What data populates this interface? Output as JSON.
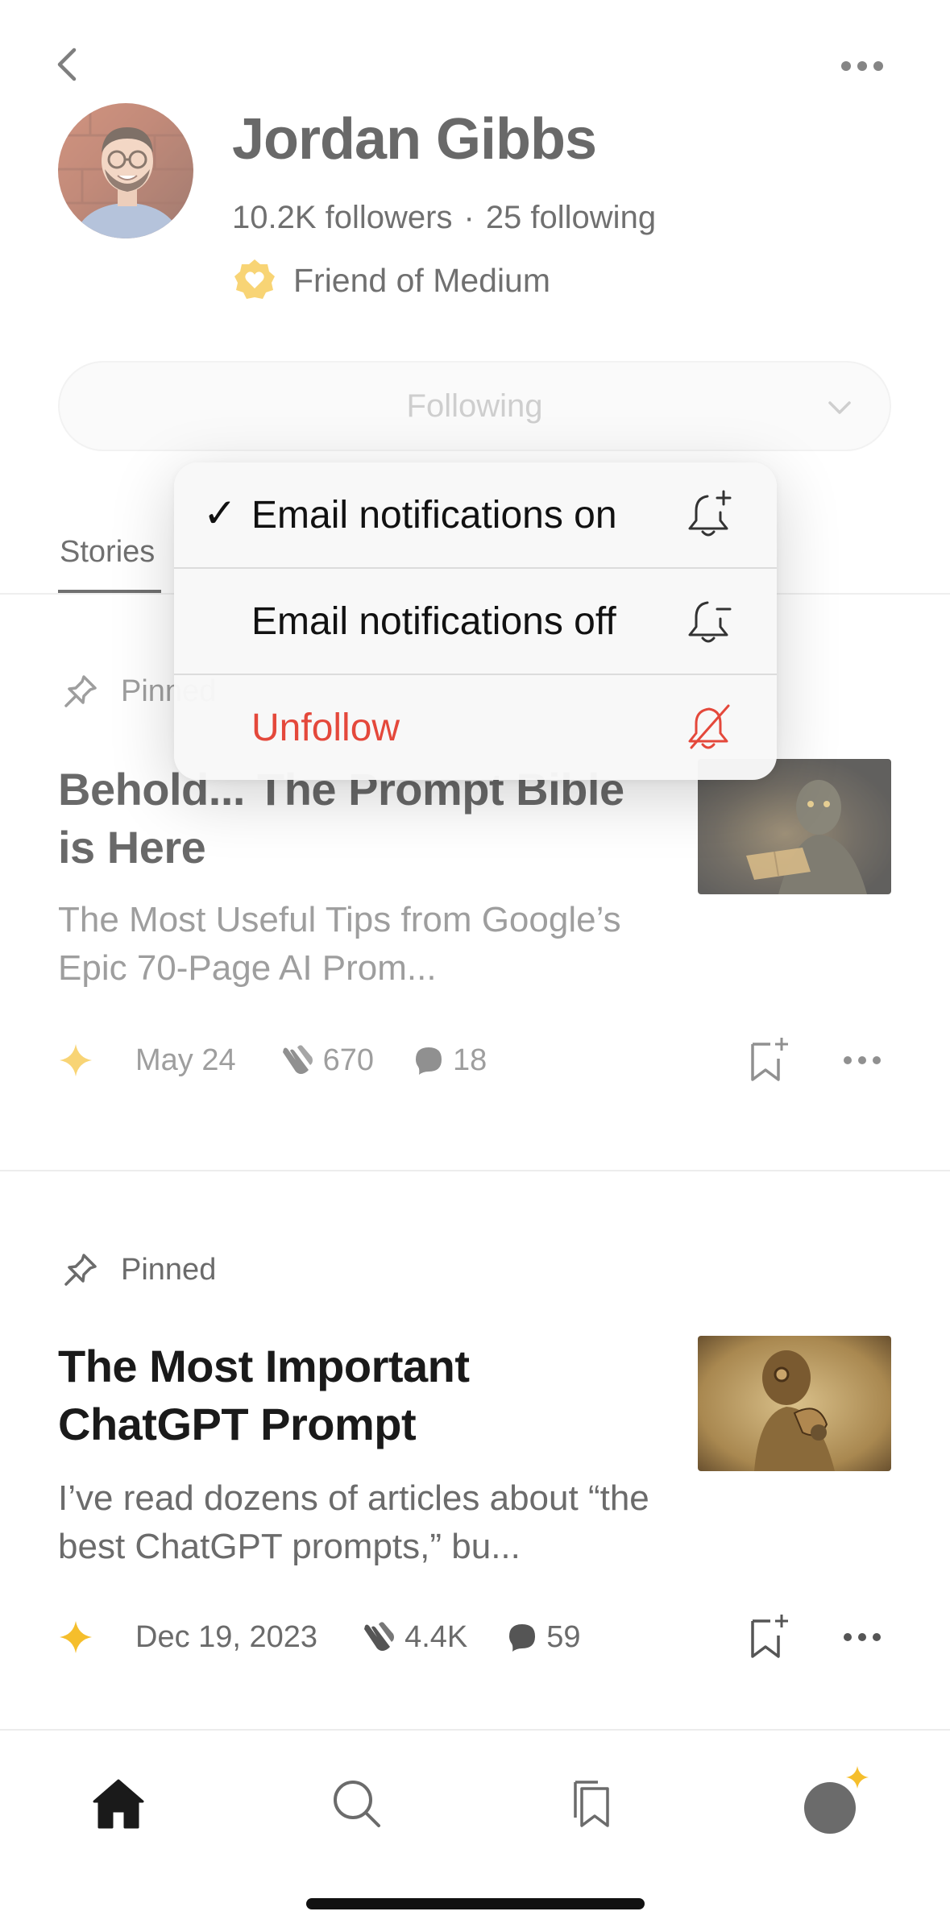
{
  "profile": {
    "name": "Jordan Gibbs",
    "followers": "10.2K followers",
    "separator": "·",
    "following": "25 following",
    "badge": "Friend of Medium"
  },
  "follow_button": {
    "label": "Following"
  },
  "tabs": {
    "stories": "Stories"
  },
  "menu": {
    "items": [
      {
        "label": "Email notifications on",
        "checked": true,
        "icon": "bell-plus-icon"
      },
      {
        "label": "Email notifications off",
        "checked": false,
        "icon": "bell-minus-icon"
      },
      {
        "label": "Unfollow",
        "danger": true,
        "icon": "bell-slash-icon"
      }
    ],
    "check_mark": "✓"
  },
  "stories": [
    {
      "pinned_label": "Pinned",
      "title": "Behold... The Prompt Bible is Here",
      "subtitle": "The Most Useful Tips from Google’s Epic 70-Page AI Prom...",
      "date": "May 24",
      "claps": "670",
      "comments": "18"
    },
    {
      "pinned_label": "Pinned",
      "title": "The Most Important ChatGPT Prompt",
      "subtitle": "I’ve read dozens of articles about “the best ChatGPT prompts,” bu...",
      "date": "Dec 19, 2023",
      "claps": "4.4K",
      "comments": "59"
    }
  ],
  "colors": {
    "member_star": "#F5BE2C",
    "badge": "#F5BE2C",
    "danger": "#E4483B",
    "text_primary": "#242424",
    "text_secondary": "#6B6B6B"
  }
}
